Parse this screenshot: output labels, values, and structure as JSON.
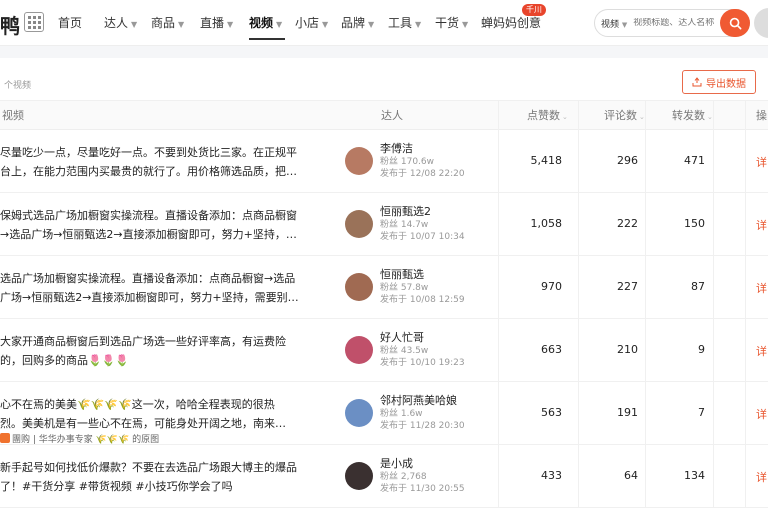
{
  "app": {
    "logo": "鸭"
  },
  "nav": [
    {
      "label": "首页",
      "caret": false
    },
    {
      "label": "达人",
      "caret": true
    },
    {
      "label": "商品",
      "caret": true
    },
    {
      "label": "直播",
      "caret": true
    },
    {
      "label": "视频",
      "caret": true,
      "active": true
    },
    {
      "label": "小店",
      "caret": true
    },
    {
      "label": "品牌",
      "caret": true
    },
    {
      "label": "工具",
      "caret": true
    },
    {
      "label": "干货",
      "caret": true
    },
    {
      "label": "蝉妈妈创意",
      "caret": false
    }
  ],
  "nav_badge": "千川",
  "search": {
    "type_label": "视频",
    "placeholder": "视频标题、达人名称"
  },
  "table": {
    "count_text": "个视频",
    "export_label": "导出数据",
    "headers": {
      "video": "视频",
      "influencer": "达人",
      "likes": "点赞数",
      "comments": "评论数",
      "shares": "转发数",
      "ops": "操"
    },
    "rows": [
      {
        "lines": [
          "尽量吃少一点，尽量吃好一点。不要到处货比三家。在正规平",
          "台上，在能力范围内买最贵的就行了。用价格筛选品质，把…"
        ],
        "tag": "",
        "name": "李傅洁",
        "fans": "粉丝 170.6w",
        "date": "发布于 12/08 22:20",
        "likes": "5,418",
        "comments": "296",
        "shares": "471",
        "op": "详",
        "avatar": "#b77a63"
      },
      {
        "lines": [
          "保姆式选品广场加橱窗实操流程。直播设备添加：点商品橱窗",
          "→选品广场→恒丽甄选2→直接添加橱窗即可，努力+坚持，…"
        ],
        "tag": "",
        "name": "恒丽甄选2",
        "fans": "粉丝 14.7w",
        "date": "发布于 10/07 10:34",
        "likes": "1,058",
        "comments": "222",
        "shares": "150",
        "op": "详",
        "avatar": "#9a7259"
      },
      {
        "lines": [
          "选品广场加橱窗实操流程。直播设备添加：点商品橱窗→选品",
          "广场→恒丽甄选2→直接添加橱窗即可，努力+坚持，需要别…"
        ],
        "tag": "",
        "name": "恒丽甄选",
        "fans": "粉丝 57.8w",
        "date": "发布于 10/08 12:59",
        "likes": "970",
        "comments": "227",
        "shares": "87",
        "op": "详",
        "avatar": "#a06a52"
      },
      {
        "lines": [
          "大家开通商品橱窗后到选品广场选一些好评率高，有运费险",
          "的，回购多的商品🌷🌷🌷"
        ],
        "tag": "",
        "name": "好人忙哥",
        "fans": "粉丝 43.5w",
        "date": "发布于 10/10 19:23",
        "likes": "663",
        "comments": "210",
        "shares": "9",
        "op": "详",
        "avatar": "#c0506a"
      },
      {
        "lines": [
          "心不在焉的美美🌾🌾🌾🌾这一次，哈哈全程表现的很热",
          "烈。美美机是有一些心不在焉，可能身处开阔之地，南来…"
        ],
        "tag": "團购 | 华华办事专家 🌾🌾🌾 的原图",
        "name": "邻村阿燕美哈娘",
        "fans": "粉丝 1.6w",
        "date": "发布于 11/28 20:30",
        "likes": "563",
        "comments": "191",
        "shares": "7",
        "op": "详",
        "avatar": "#6b8fc4"
      },
      {
        "lines": [
          "新手起号如何找低价爆款？不要在去选品广场跟大博主的爆品",
          "了！#干货分享 #带货视频 #小技巧你学会了吗"
        ],
        "tag": "",
        "name": "是小成",
        "fans": "粉丝 2,768",
        "date": "发布于 11/30 20:55",
        "likes": "433",
        "comments": "64",
        "shares": "134",
        "op": "详",
        "avatar": "#3a3030"
      }
    ]
  }
}
